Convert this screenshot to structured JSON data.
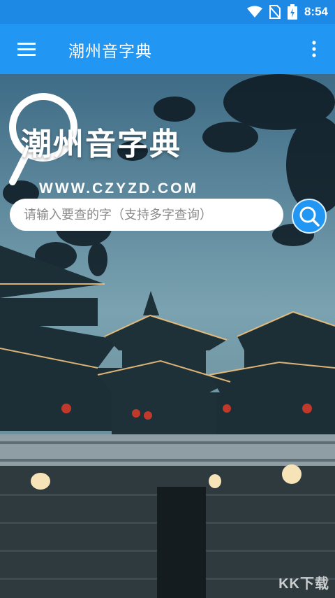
{
  "status_bar": {
    "time": "8:54",
    "icons": [
      "wifi-icon",
      "no-sim-icon",
      "battery-charging-icon"
    ]
  },
  "app_bar": {
    "title": "潮州音字典",
    "left_icon": "hamburger-menu-icon",
    "right_icon": "overflow-menu-icon"
  },
  "logo": {
    "title": "潮州音字典",
    "url": "WWW.CZYZD.COM"
  },
  "search": {
    "placeholder": "请输入要查的字（支持多字查询）",
    "button_icon": "search-icon"
  },
  "watermark": "KK下载",
  "colors": {
    "status_bar": "#1e88e5",
    "app_bar": "#2196f3",
    "accent": "#2196f3",
    "text_on_primary": "#ffffff"
  }
}
